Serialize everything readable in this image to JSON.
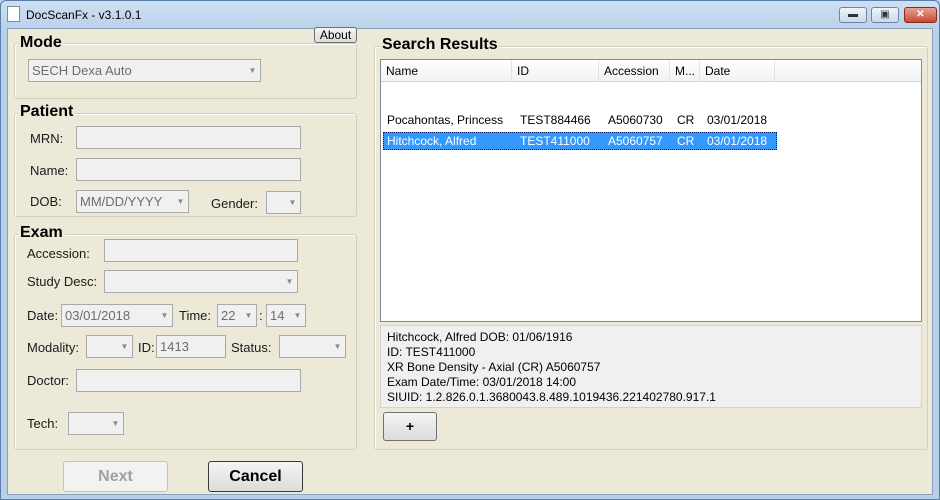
{
  "window": {
    "title": "DocScanFx  -  v3.1.0.1",
    "minimize": "▬",
    "maximize": "▣",
    "close": "✕"
  },
  "about": {
    "label": "About"
  },
  "mode": {
    "label": "Mode",
    "value": "SECH Dexa Auto"
  },
  "patient": {
    "label": "Patient",
    "mrn_label": "MRN:",
    "mrn_value": "",
    "name_label": "Name:",
    "name_value": "",
    "dob_label": "DOB:",
    "dob_placeholder": "MM/DD/YYYY",
    "gender_label": "Gender:",
    "gender_value": ""
  },
  "exam": {
    "label": "Exam",
    "accession_label": "Accession:",
    "accession_value": "",
    "study_label": "Study Desc:",
    "study_value": "",
    "date_label": "Date:",
    "date_value": "03/01/2018",
    "time_label": "Time:",
    "hour": "22",
    "sep": ":",
    "minute": "14",
    "modality_label": "Modality:",
    "modality_value": "",
    "id_label": "ID:",
    "id_value": "1413",
    "status_label": "Status:",
    "status_value": "",
    "doctor_label": "Doctor:",
    "doctor_value": "",
    "tech_label": "Tech:",
    "tech_value": ""
  },
  "buttons": {
    "next": "Next",
    "cancel": "Cancel",
    "plus": "+"
  },
  "results": {
    "label": "Search Results",
    "columns": [
      "Name",
      "ID",
      "Accession",
      "M...",
      "Date"
    ],
    "rows": [
      {
        "name": "Pocahontas, Princess",
        "id": "TEST884466",
        "accession": "A5060730",
        "modality": "CR",
        "date": "03/01/2018"
      },
      {
        "name": "Hitchcock, Alfred",
        "id": "TEST411000",
        "accession": "A5060757",
        "modality": "CR",
        "date": "03/01/2018"
      }
    ],
    "details": [
      "Hitchcock, Alfred     DOB: 01/06/1916",
      "ID: TEST411000",
      "XR Bone Density - Axial (CR)   A5060757",
      "Exam Date/Time: 03/01/2018   14:00",
      "SIUID: 1.2.826.0.1.3680043.8.489.1019436.221402780.917.1"
    ]
  },
  "icons": {
    "dropdown": "chevron-down-icon"
  }
}
